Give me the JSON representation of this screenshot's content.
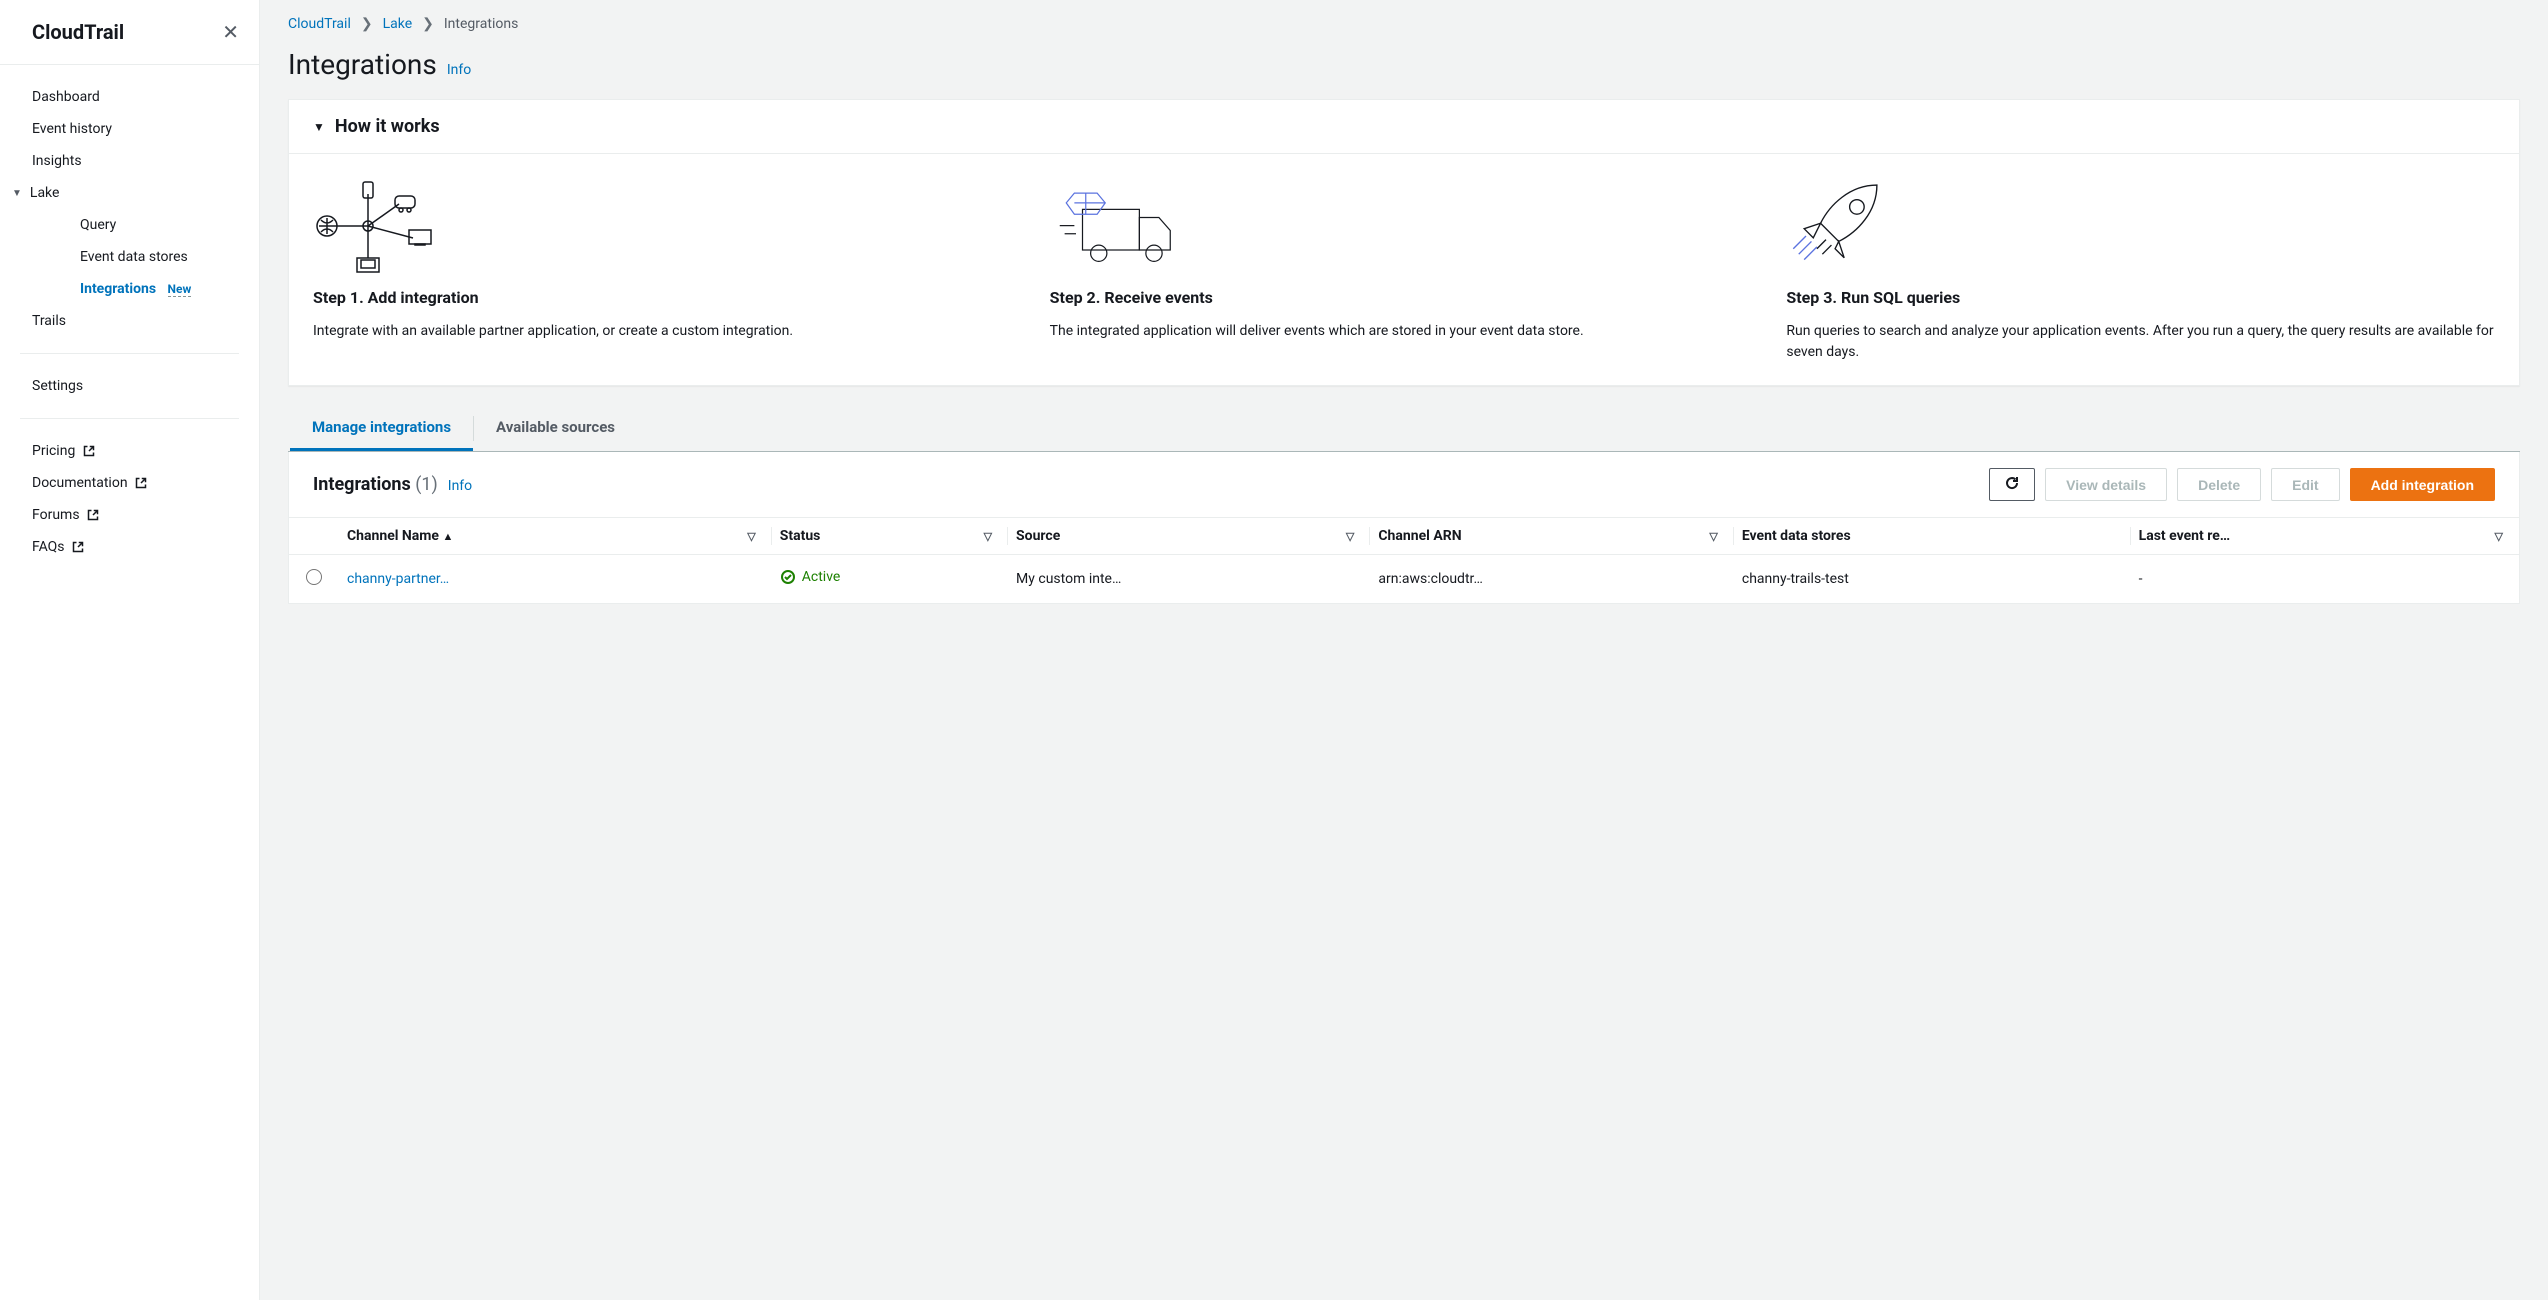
{
  "sidebar": {
    "title": "CloudTrail",
    "items": {
      "dashboard": "Dashboard",
      "eventHistory": "Event history",
      "insights": "Insights",
      "lake": "Lake",
      "query": "Query",
      "eventDataStores": "Event data stores",
      "integrations": "Integrations",
      "newBadge": "New",
      "trails": "Trails",
      "settings": "Settings",
      "pricing": "Pricing",
      "documentation": "Documentation",
      "forums": "Forums",
      "faqs": "FAQs"
    }
  },
  "breadcrumb": {
    "root": "CloudTrail",
    "mid": "Lake",
    "current": "Integrations"
  },
  "page": {
    "title": "Integrations",
    "info": "Info"
  },
  "howItWorks": {
    "title": "How it works",
    "steps": [
      {
        "title": "Step 1. Add integration",
        "desc": "Integrate with an available partner application, or create a custom integration."
      },
      {
        "title": "Step 2. Receive events",
        "desc": "The integrated application will deliver events which are stored in your event data store."
      },
      {
        "title": "Step 3. Run SQL queries",
        "desc": "Run queries to search and analyze your application events. After you run a query, the query results are available for seven days."
      }
    ]
  },
  "tabs": {
    "manage": "Manage integrations",
    "sources": "Available sources"
  },
  "table": {
    "title": "Integrations",
    "count": "(1)",
    "info": "Info",
    "actions": {
      "viewDetails": "View details",
      "delete": "Delete",
      "edit": "Edit",
      "add": "Add integration"
    },
    "columns": {
      "channelName": "Channel Name",
      "status": "Status",
      "source": "Source",
      "channelArn": "Channel ARN",
      "eventDataStores": "Event data stores",
      "lastEvent": "Last event re…"
    },
    "rows": [
      {
        "channelName": "channy-partner…",
        "status": "Active",
        "source": "My custom inte…",
        "channelArn": "arn:aws:cloudtr…",
        "eventDataStores": "channy-trails-test",
        "lastEvent": "-"
      }
    ]
  }
}
